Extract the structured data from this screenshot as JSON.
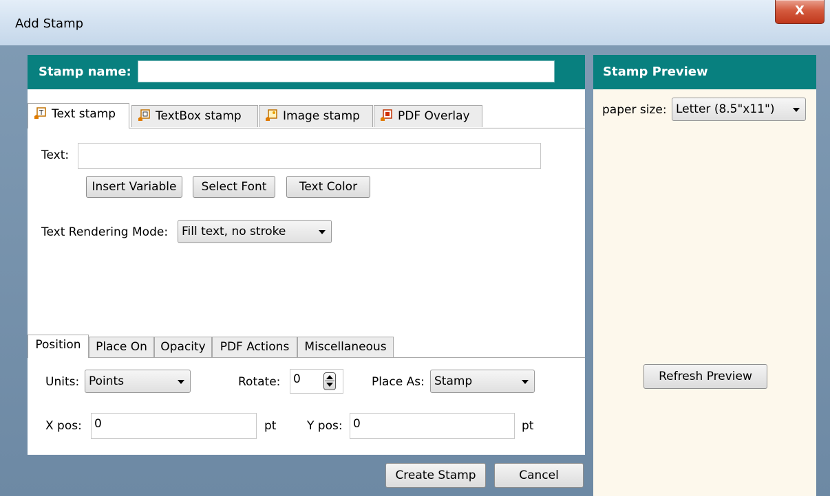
{
  "window": {
    "title": "Add Stamp",
    "close_label": "X"
  },
  "stamp_name": {
    "label": "Stamp name:",
    "value": ""
  },
  "tabs": [
    {
      "label": "Text stamp",
      "icon": "text-stamp-icon",
      "active": true
    },
    {
      "label": "TextBox stamp",
      "icon": "textbox-stamp-icon",
      "active": false
    },
    {
      "label": "Image stamp",
      "icon": "image-stamp-icon",
      "active": false
    },
    {
      "label": "PDF Overlay",
      "icon": "pdf-overlay-icon",
      "active": false
    }
  ],
  "text_tab": {
    "text_label": "Text:",
    "text_value": "",
    "insert_variable": "Insert Variable",
    "select_font": "Select Font",
    "text_color": "Text Color",
    "rendering_mode_label": "Text Rendering Mode:",
    "rendering_mode_value": "Fill text, no stroke"
  },
  "subtabs": [
    {
      "label": "Position",
      "active": true
    },
    {
      "label": "Place On",
      "active": false
    },
    {
      "label": "Opacity",
      "active": false
    },
    {
      "label": "PDF Actions",
      "active": false
    },
    {
      "label": "Miscellaneous",
      "active": false
    }
  ],
  "position": {
    "units_label": "Units:",
    "units_value": "Points",
    "rotate_label": "Rotate:",
    "rotate_value": "0",
    "place_as_label": "Place As:",
    "place_as_value": "Stamp",
    "xpos_label": "X pos:",
    "xpos_value": "0",
    "xpos_unit": "pt",
    "ypos_label": "Y pos:",
    "ypos_value": "0",
    "ypos_unit": "pt"
  },
  "actions": {
    "create": "Create Stamp",
    "cancel": "Cancel"
  },
  "preview": {
    "title": "Stamp Preview",
    "paper_size_label": "paper size:",
    "paper_size_value": "Letter (8.5\"x11\")",
    "refresh": "Refresh Preview"
  },
  "colors": {
    "header_teal": "#08807f",
    "preview_bg": "#fdf8ec",
    "frame": "#7f9ab3"
  }
}
